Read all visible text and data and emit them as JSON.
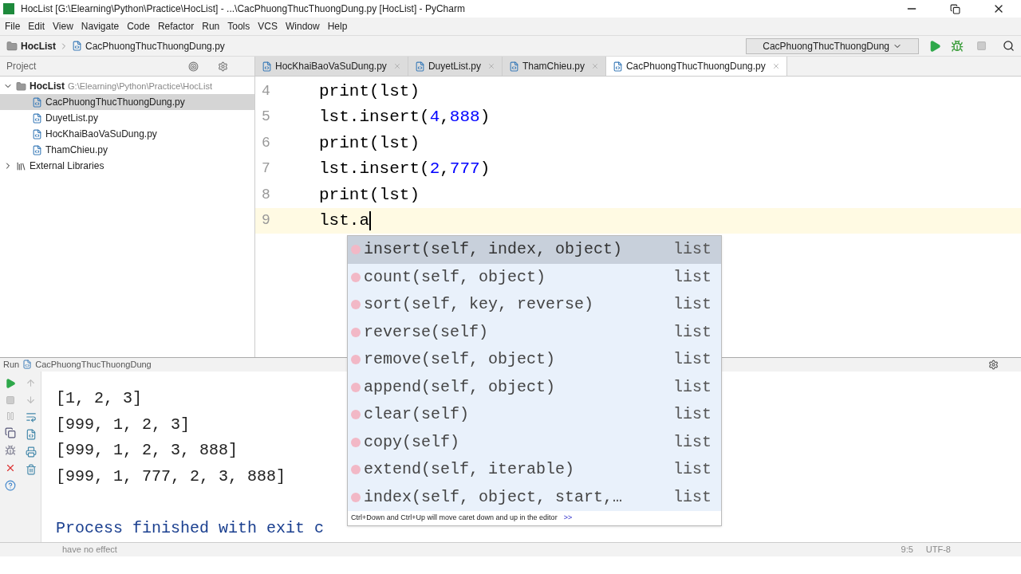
{
  "window": {
    "title": "HocList [G:\\Elearning\\Python\\Practice\\HocList] - ...\\CacPhuongThucThuongDung.py [HocList] - PyCharm"
  },
  "menu": [
    "File",
    "Edit",
    "View",
    "Navigate",
    "Code",
    "Refactor",
    "Run",
    "Tools",
    "VCS",
    "Window",
    "Help"
  ],
  "breadcrumbs": [
    "HocList",
    "CacPhuongThucThuongDung.py"
  ],
  "run_config": "CacPhuongThucThuongDung",
  "project": {
    "label": "Project",
    "root": {
      "name": "HocList",
      "path": "G:\\Elearning\\Python\\Practice\\HocList",
      "expanded": true,
      "children": [
        {
          "name": "CacPhuongThucThuongDung.py",
          "selected": true
        },
        {
          "name": "DuyetList.py",
          "selected": false
        },
        {
          "name": "HocKhaiBaoVaSuDung.py",
          "selected": false
        },
        {
          "name": "ThamChieu.py",
          "selected": false
        }
      ]
    },
    "libraries": {
      "name": "External Libraries",
      "expanded": false
    }
  },
  "tabs": [
    {
      "label": "HocKhaiBaoVaSuDung.py",
      "selected": false
    },
    {
      "label": "DuyetList.py",
      "selected": false
    },
    {
      "label": "ThamChieu.py",
      "selected": false
    },
    {
      "label": "CacPhuongThucThuongDung.py",
      "selected": true
    }
  ],
  "editor": {
    "lines": [
      {
        "number": "4",
        "code": "print(lst)",
        "current": false
      },
      {
        "number": "5",
        "code": "lst.insert(4,888)",
        "current": false
      },
      {
        "number": "6",
        "code": "print(lst)",
        "current": false
      },
      {
        "number": "7",
        "code": "lst.insert(2,777)",
        "current": false
      },
      {
        "number": "8",
        "code": "print(lst)",
        "current": false
      },
      {
        "number": "9",
        "code": "lst.a",
        "current": true
      }
    ]
  },
  "completion": {
    "items": [
      {
        "signature": "insert(self, index, object)",
        "type": "list",
        "selected": true
      },
      {
        "signature": "count(self, object)",
        "type": "list",
        "selected": false
      },
      {
        "signature": "sort(self, key, reverse)",
        "type": "list",
        "selected": false
      },
      {
        "signature": "reverse(self)",
        "type": "list",
        "selected": false
      },
      {
        "signature": "remove(self, object)",
        "type": "list",
        "selected": false
      },
      {
        "signature": "append(self, object)",
        "type": "list",
        "selected": false
      },
      {
        "signature": "clear(self)",
        "type": "list",
        "selected": false
      },
      {
        "signature": "copy(self)",
        "type": "list",
        "selected": false
      },
      {
        "signature": "extend(self, iterable)",
        "type": "list",
        "selected": false
      },
      {
        "signature": "index(self, object, start,…",
        "type": "list",
        "selected": false
      }
    ],
    "hint": "Ctrl+Down and Ctrl+Up will move caret down and up in the editor",
    "hint_link": ">>"
  },
  "run": {
    "label": "Run",
    "config": "CacPhuongThucThuongDung",
    "output": [
      "[1, 2, 3]",
      "[999, 1, 2, 3]",
      "[999, 1, 2, 3, 888]",
      "[999, 1, 777, 2, 3, 888]"
    ],
    "exit_message": "Process finished with exit c"
  },
  "status_bar": {
    "message": "have no effect",
    "position": "9:5",
    "encoding": "UTF-8"
  }
}
